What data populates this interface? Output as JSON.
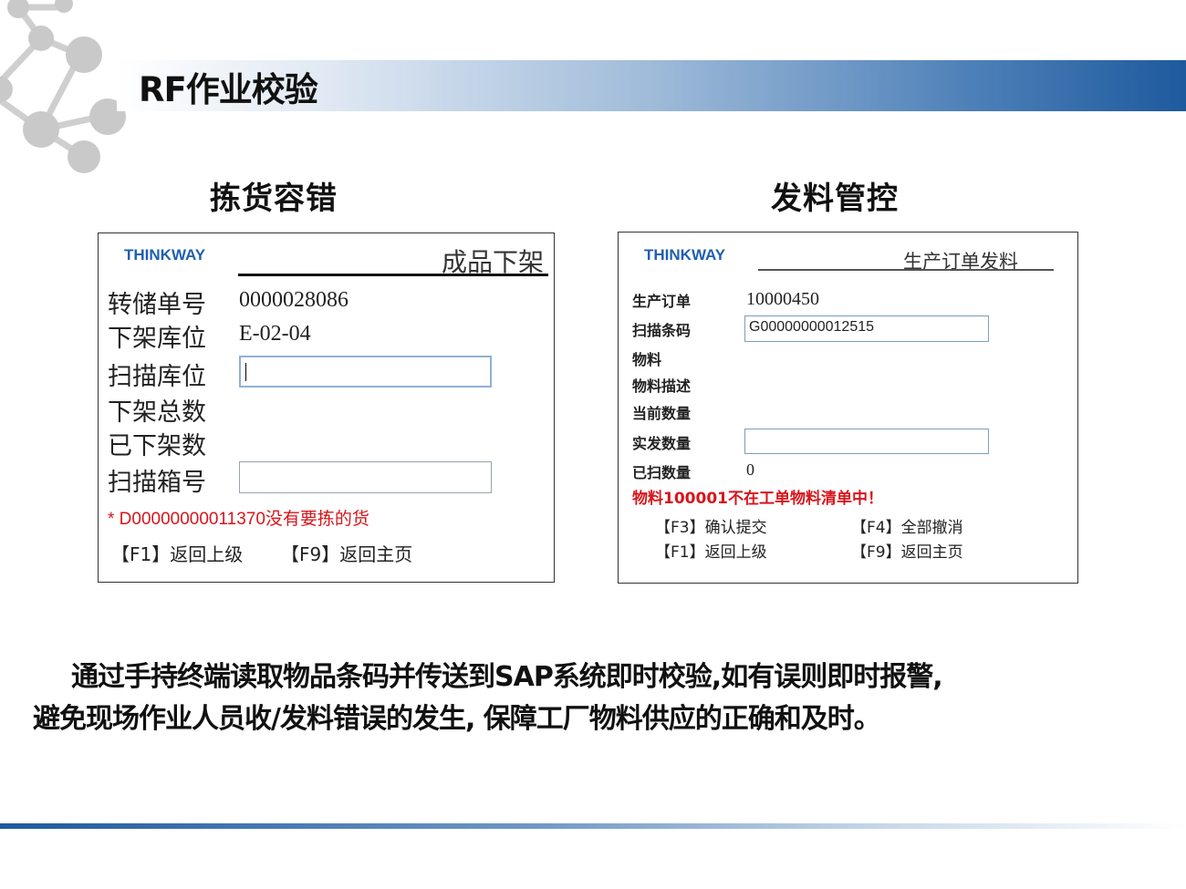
{
  "slide_title": "RF作业校验",
  "sections": {
    "left_heading": "拣货容错",
    "right_heading": "发料管控"
  },
  "left_screen": {
    "brand": "THINKWAY",
    "title": "成品下架",
    "rows": [
      {
        "label": "转储单号",
        "value": "0000028086"
      },
      {
        "label": "下架库位",
        "value": "E-02-04"
      },
      {
        "label": "扫描库位",
        "value": ""
      },
      {
        "label": "下架总数",
        "value": ""
      },
      {
        "label": "已下架数",
        "value": ""
      },
      {
        "label": "扫描箱号",
        "value": ""
      }
    ],
    "error": "* D00000000011370没有要拣的货",
    "fkeys": [
      "【F1】返回上级",
      "【F9】返回主页"
    ]
  },
  "right_screen": {
    "brand": "THINKWAY",
    "title": "生产订单发料",
    "rows": [
      {
        "label": "生产订单",
        "value": "10000450"
      },
      {
        "label": "扫描条码",
        "value": "G00000000012515"
      },
      {
        "label": "物料",
        "value": ""
      },
      {
        "label": "物料描述",
        "value": ""
      },
      {
        "label": "当前数量",
        "value": ""
      },
      {
        "label": "实发数量",
        "value": ""
      },
      {
        "label": "已扫数量",
        "value": "0"
      }
    ],
    "error": "物料100001不在工单物料清单中！",
    "fkeys": [
      "【F3】确认提交",
      "【F4】全部撤消",
      "【F1】返回上级",
      "【F9】返回主页"
    ]
  },
  "description": {
    "line1": "通过手持终端读取物品条码并传送到SAP系统即时校验,如有误则即时报警,",
    "line2": "避免现场作业人员收/发料错误的发生, 保障工厂物料供应的正确和及时。"
  },
  "colors": {
    "brand_blue": "#1f5fb0",
    "error_red": "#d8151b",
    "banner_dark": "#1e5a9e",
    "molecule_grey": "#c9c9c9"
  }
}
